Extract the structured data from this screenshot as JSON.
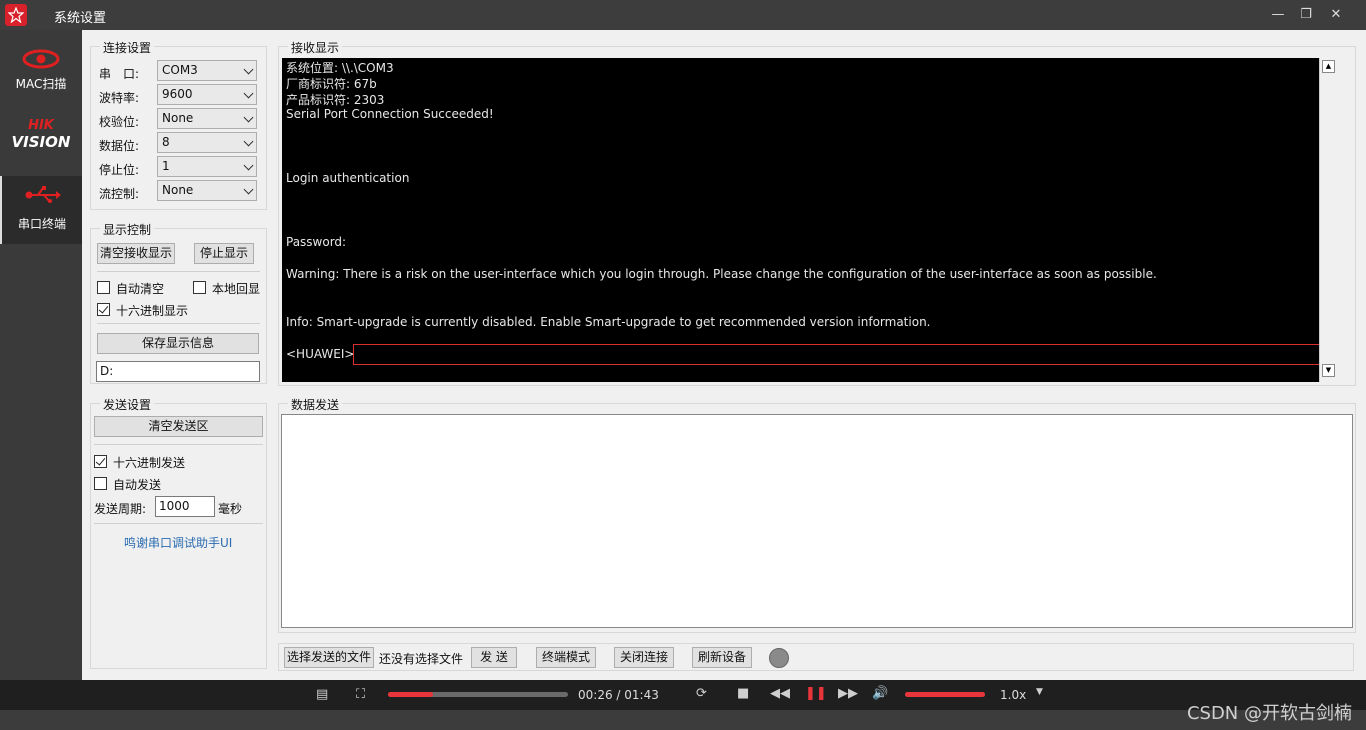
{
  "window": {
    "title": "系统设置"
  },
  "sidebar": {
    "items": [
      {
        "label": "MAC扫描"
      },
      {
        "label": "HIK VISION"
      },
      {
        "label": "串口终端"
      }
    ]
  },
  "connection": {
    "title": "连接设置",
    "fields": [
      {
        "label": "串　口:",
        "value": "COM3"
      },
      {
        "label": "波特率:",
        "value": "9600"
      },
      {
        "label": "校验位:",
        "value": "None"
      },
      {
        "label": "数据位:",
        "value": "8"
      },
      {
        "label": "停止位:",
        "value": "1"
      },
      {
        "label": "流控制:",
        "value": "None"
      }
    ]
  },
  "display": {
    "title": "显示控制",
    "clear_btn": "清空接收显示",
    "stop_btn": "停止显示",
    "auto_clear": "自动清空",
    "local_echo": "本地回显",
    "hex_display": "十六进制显示",
    "save_btn": "保存显示信息",
    "path": "D:"
  },
  "send_settings": {
    "title": "发送设置",
    "clear_btn": "清空发送区",
    "hex_send": "十六进制发送",
    "auto_send": "自动发送",
    "period_label": "发送周期:",
    "period_value": "1000",
    "period_unit": "毫秒",
    "thanks": "鸣谢串口调试助手UI"
  },
  "receive": {
    "title": "接收显示",
    "lines": [
      "系统位置: \\\\.\\COM3",
      "厂商标识符: 67b",
      "产品标识符: 2303",
      "Serial Port Connection Succeeded!",
      "Login authentication",
      "Password:",
      "Warning: There is a risk on the user-interface which you login through. Please change the configuration of the user-interface as soon as possible.",
      "Info: Smart-upgrade is currently disabled. Enable Smart-upgrade to get recommended version information.",
      "<HUAWEI>"
    ]
  },
  "send_data": {
    "title": "数据发送"
  },
  "bottom": {
    "choose_file": "选择发送的文件",
    "no_file": "还没有选择文件",
    "send": "发 送",
    "terminal_mode": "终端模式",
    "close_conn": "关闭连接",
    "refresh": "刷新设备"
  },
  "player": {
    "time": "00:26 / 01:43",
    "progress": 0.25,
    "speed": "1.0x",
    "volume": 1.0
  },
  "watermark": "CSDN @开软古剑楠",
  "colors": {
    "accent": "#d8212a",
    "terminal_bg": "#000000"
  }
}
